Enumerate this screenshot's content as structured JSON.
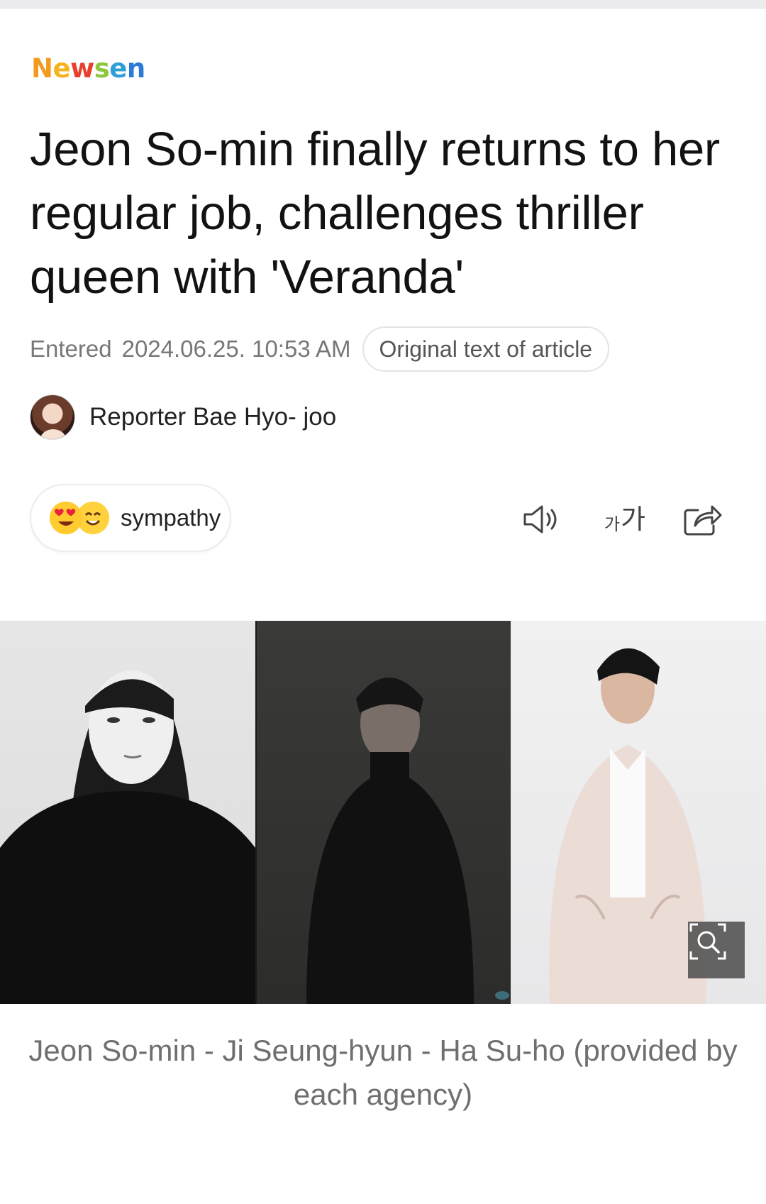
{
  "brand": {
    "letters": [
      "N",
      "e",
      "w",
      "s",
      "e",
      "n"
    ],
    "colors": [
      "#f39b1f",
      "#f5b41f",
      "#e7412d",
      "#8dc63f",
      "#2f9fd8",
      "#2a7bd6"
    ]
  },
  "article": {
    "headline": "Jeon So-min finally returns to her regular job, challenges thriller queen with 'Veranda'",
    "entered_label": "Entered",
    "entered_date": "2024.06.25. 10:53 AM",
    "original_button": "Original text of article"
  },
  "reporter": {
    "name": "Reporter Bae Hyo- joo"
  },
  "actions": {
    "sympathy_label": "sympathy",
    "font_size_small": "가",
    "font_size_big": "가",
    "icons": [
      "speaker-icon",
      "font-size-icon",
      "share-icon"
    ]
  },
  "photo": {
    "caption": "Jeon So-min - Ji Seung-hyun - Ha Su-ho (provided by each agency)"
  }
}
